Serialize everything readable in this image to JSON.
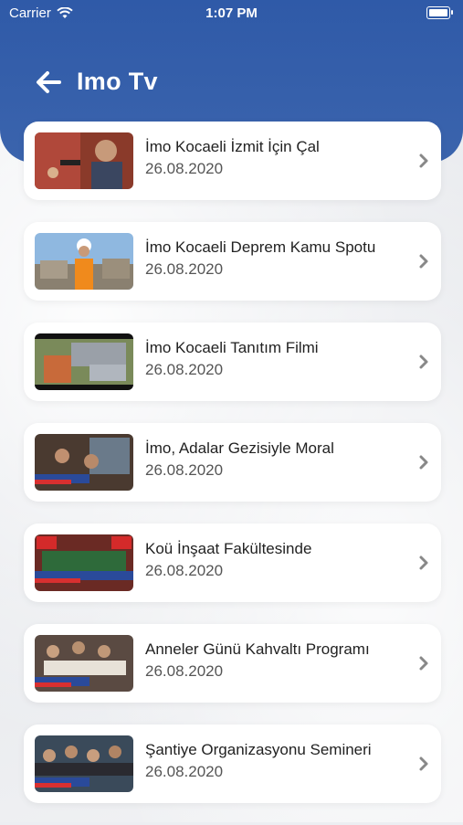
{
  "status_bar": {
    "carrier": "Carrier",
    "time": "1:07 PM"
  },
  "header": {
    "title": "Imo Tv"
  },
  "icons": {
    "back": "arrow-left-icon",
    "chevron": "chevron-right-icon",
    "wifi": "wifi-icon",
    "battery": "battery-icon"
  },
  "colors": {
    "header": "#3360ac",
    "card": "#ffffff",
    "text": "#222222",
    "chevron": "#888888"
  },
  "videos": [
    {
      "title": "İmo Kocaeli İzmit İçin Çal",
      "date": "26.08.2020"
    },
    {
      "title": "İmo Kocaeli Deprem Kamu Spotu",
      "date": "26.08.2020"
    },
    {
      "title": "İmo Kocaeli Tanıtım Filmi",
      "date": "26.08.2020"
    },
    {
      "title": "İmo, Adalar Gezisiyle Moral",
      "date": "26.08.2020"
    },
    {
      "title": "Koü İnşaat Fakültesinde",
      "date": "26.08.2020"
    },
    {
      "title": "Anneler Günü Kahvaltı Programı",
      "date": "26.08.2020"
    },
    {
      "title": "Şantiye Organizasyonu Semineri",
      "date": "26.08.2020"
    }
  ]
}
